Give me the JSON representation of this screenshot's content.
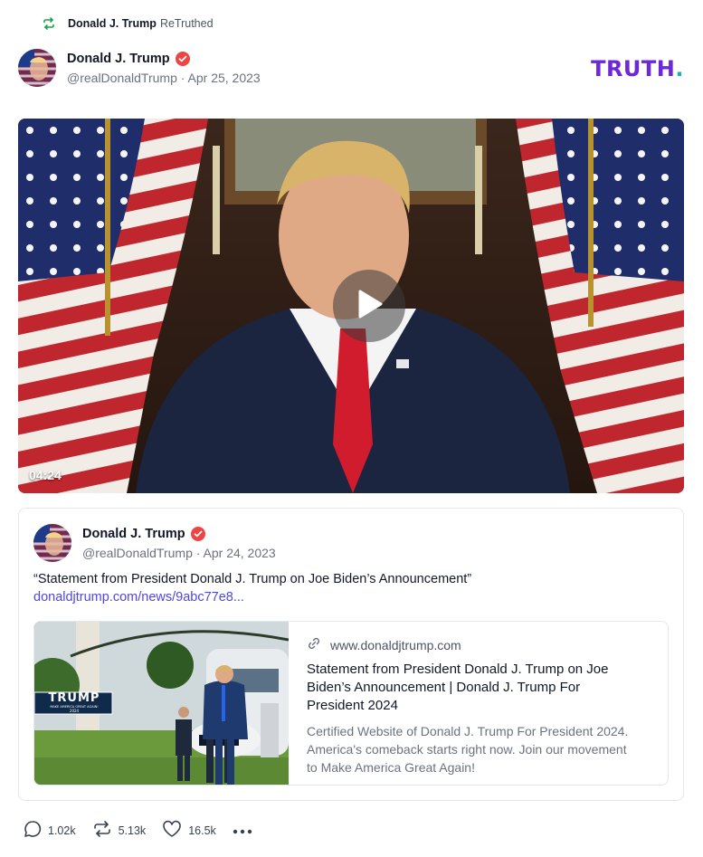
{
  "retruth": {
    "user": "Donald J. Trump",
    "label": "ReTruthed"
  },
  "post": {
    "author_name": "Donald J. Trump",
    "handle": "@realDonaldTrump",
    "date": "Apr 25, 2023",
    "handle_line": "@realDonaldTrump · Apr 25, 2023"
  },
  "brand": {
    "text": "TRUTH",
    "dot": "."
  },
  "video": {
    "duration": "04:24"
  },
  "quoted": {
    "author_name": "Donald J. Trump",
    "handle_line": "@realDonaldTrump · Apr 24, 2023",
    "text": "“Statement from President Donald J. Trump on Joe Biden’s Announcement”",
    "link_text": "donaldjtrump.com/news/9abc77e8...",
    "link_card": {
      "domain": "www.donaldjtrump.com",
      "title": "Statement from President Donald J. Trump on Joe Biden’s Announcement | Donald J. Trump For President 2024",
      "description": "Certified Website of Donald J. Trump For President 2024. America's comeback starts right now. Join our movement to Make America Great Again!",
      "thumb_sign": "TRUMP",
      "thumb_sign_small": "MAKE AMERICA GREAT AGAIN!",
      "thumb_sign_year": "2024"
    }
  },
  "actions": {
    "replies": "1.02k",
    "retruths": "5.13k",
    "likes": "16.5k"
  },
  "colors": {
    "brand": "#6d28d9",
    "brand_dot": "#14b8a6",
    "verified": "#ef4444",
    "retruth_icon": "#16a34a",
    "link": "#4f46e5"
  }
}
